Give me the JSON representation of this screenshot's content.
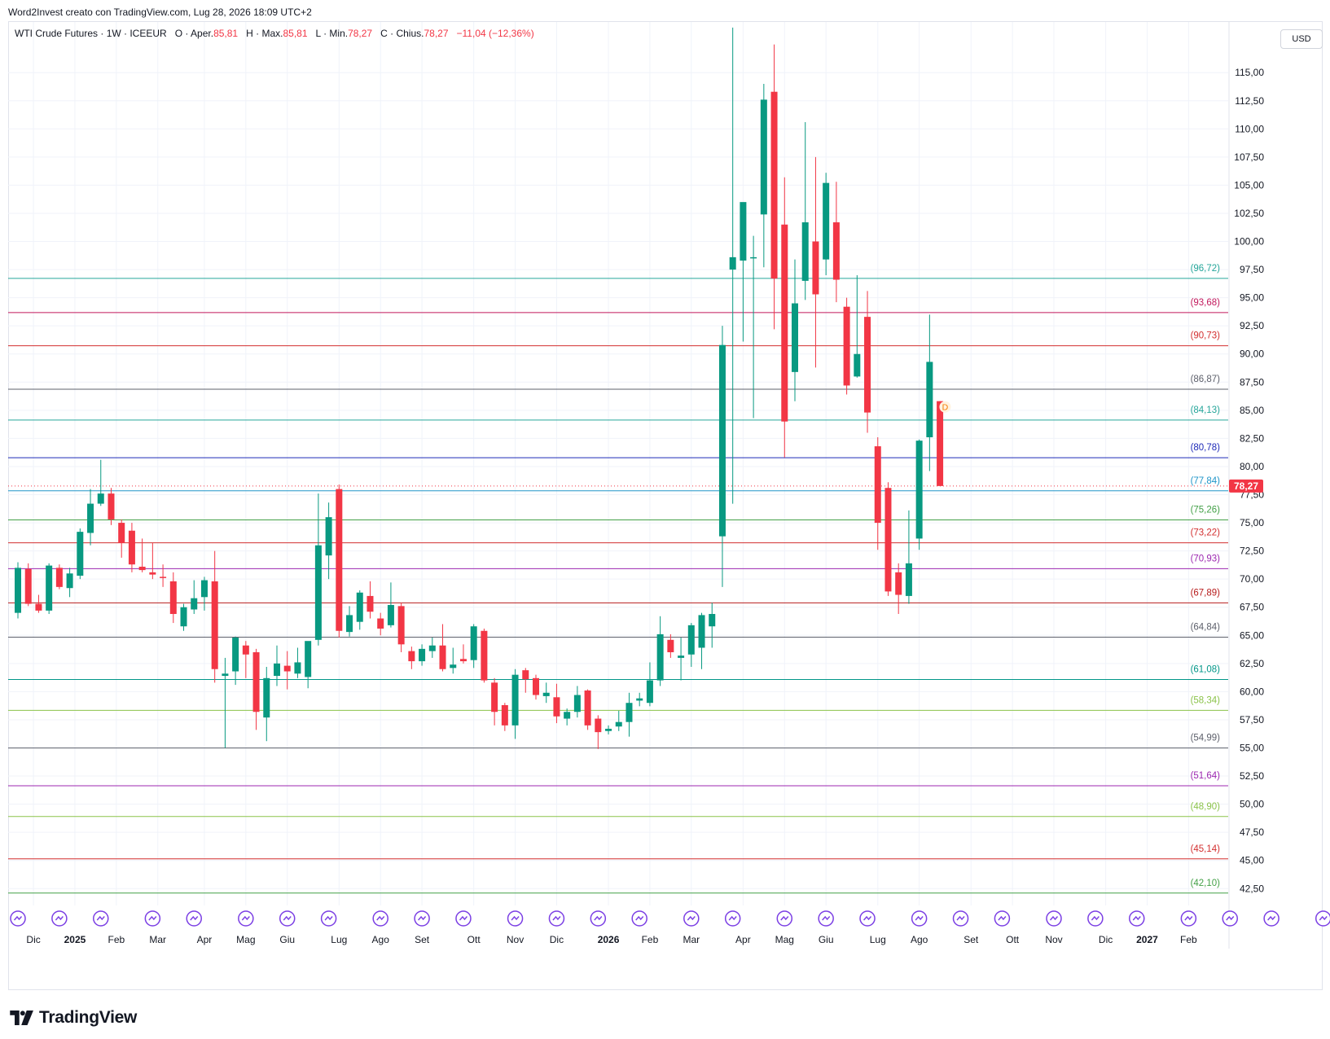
{
  "header": {
    "credit": "Word2Invest creato con TradingView.com, Lug 28, 2026 18:09 UTC+2"
  },
  "legend": {
    "symbol": "WTI Crude Futures · 1W · ICEEUR",
    "open_label": "O · Aper.",
    "open": "85,81",
    "high_label": "H · Max.",
    "high": "85,81",
    "low_label": "L · Min.",
    "low": "78,27",
    "close_label": "C · Chius.",
    "close": "78,27",
    "change": "−11,04 (−12,36%)"
  },
  "currency": "USD",
  "brand": "TradingView",
  "colors": {
    "up": "#089981",
    "down": "#f23645",
    "grid": "#f0f3fa",
    "text": "#131722",
    "event": "#7b3fe4"
  },
  "chart_data": {
    "type": "candlestick",
    "y_axis": {
      "range": [
        41.0,
        119.5
      ],
      "ticks": [
        "42,50",
        "45,00",
        "47,50",
        "50,00",
        "52,50",
        "55,00",
        "57,50",
        "60,00",
        "62,50",
        "65,00",
        "67,50",
        "70,00",
        "72,50",
        "75,00",
        "77,50",
        "80,00",
        "82,50",
        "85,00",
        "87,50",
        "90,00",
        "92,50",
        "95,00",
        "97,50",
        "100,00",
        "102,50",
        "105,00",
        "107,50",
        "110,00",
        "112,50",
        "115,00"
      ]
    },
    "x_axis": {
      "labels": [
        {
          "label": "Dic",
          "bar": 1.5,
          "bold": false
        },
        {
          "label": "2025",
          "bar": 5.5,
          "bold": true
        },
        {
          "label": "Feb",
          "bar": 9.5,
          "bold": false
        },
        {
          "label": "Mar",
          "bar": 13.5,
          "bold": false
        },
        {
          "label": "Apr",
          "bar": 18,
          "bold": false
        },
        {
          "label": "Mag",
          "bar": 22,
          "bold": false
        },
        {
          "label": "Giu",
          "bar": 26,
          "bold": false
        },
        {
          "label": "Lug",
          "bar": 31,
          "bold": false
        },
        {
          "label": "Ago",
          "bar": 35,
          "bold": false
        },
        {
          "label": "Set",
          "bar": 39,
          "bold": false
        },
        {
          "label": "Ott",
          "bar": 44,
          "bold": false
        },
        {
          "label": "Nov",
          "bar": 48,
          "bold": false
        },
        {
          "label": "Dic",
          "bar": 52,
          "bold": false
        },
        {
          "label": "2026",
          "bar": 57,
          "bold": true
        },
        {
          "label": "Feb",
          "bar": 61,
          "bold": false
        },
        {
          "label": "Mar",
          "bar": 65,
          "bold": false
        },
        {
          "label": "Apr",
          "bar": 70,
          "bold": false
        },
        {
          "label": "Mag",
          "bar": 74,
          "bold": false
        },
        {
          "label": "Giu",
          "bar": 78,
          "bold": false
        },
        {
          "label": "Lug",
          "bar": 83,
          "bold": false
        },
        {
          "label": "Ago",
          "bar": 87,
          "bold": false
        },
        {
          "label": "Set",
          "bar": 92,
          "bold": false
        },
        {
          "label": "Ott",
          "bar": 96,
          "bold": false
        },
        {
          "label": "Nov",
          "bar": 100,
          "bold": false
        },
        {
          "label": "Dic",
          "bar": 105,
          "bold": false
        },
        {
          "label": "2027",
          "bar": 109,
          "bold": true
        },
        {
          "label": "Feb",
          "bar": 113,
          "bold": false
        }
      ]
    },
    "event_markers": [
      0,
      4,
      8,
      13,
      17,
      22,
      26,
      30,
      35,
      39,
      43,
      48,
      52,
      56,
      60,
      65,
      69,
      74,
      78,
      82,
      87,
      91,
      95,
      100,
      104,
      108,
      113,
      117,
      121,
      126,
      130,
      134
    ],
    "levels": [
      {
        "value": 96.72,
        "label": "(96,72)",
        "color": "#26a69a"
      },
      {
        "value": 93.68,
        "label": "(93,68)",
        "color": "#c2185b"
      },
      {
        "value": 90.73,
        "label": "(90,73)",
        "color": "#d32f2f"
      },
      {
        "value": 86.87,
        "label": "(86,87)",
        "color": "#5d606b"
      },
      {
        "value": 84.13,
        "label": "(84,13)",
        "color": "#26a69a"
      },
      {
        "value": 80.78,
        "label": "(80,78)",
        "color": "#1e2ab8"
      },
      {
        "value": 77.84,
        "label": "(77,84)",
        "color": "#2196c9"
      },
      {
        "value": 75.26,
        "label": "(75,26)",
        "color": "#43a047"
      },
      {
        "value": 73.22,
        "label": "(73,22)",
        "color": "#d32f2f"
      },
      {
        "value": 70.93,
        "label": "(70,93)",
        "color": "#9c27b0"
      },
      {
        "value": 67.89,
        "label": "(67,89)",
        "color": "#b71c1c"
      },
      {
        "value": 64.84,
        "label": "(64,84)",
        "color": "#5d606b"
      },
      {
        "value": 61.08,
        "label": "(61,08)",
        "color": "#009688"
      },
      {
        "value": 58.34,
        "label": "(58,34)",
        "color": "#8bc34a"
      },
      {
        "value": 54.99,
        "label": "(54,99)",
        "color": "#5d606b"
      },
      {
        "value": 51.64,
        "label": "(51,64)",
        "color": "#9c27b0"
      },
      {
        "value": 48.9,
        "label": "(48,90)",
        "color": "#8bc34a"
      },
      {
        "value": 45.14,
        "label": "(45,14)",
        "color": "#d32f2f"
      },
      {
        "value": 42.1,
        "label": "(42,10)",
        "color": "#43a047"
      }
    ],
    "last_price": {
      "value": 78.27,
      "label": "78,27"
    },
    "dividend_marker": {
      "bar": 89.5,
      "value": 85.3,
      "label": "D"
    },
    "candles": [
      {
        "o": 67.0,
        "h": 71.5,
        "l": 66.5,
        "c": 71.0
      },
      {
        "o": 70.9,
        "h": 71.4,
        "l": 67.6,
        "c": 67.8
      },
      {
        "o": 67.8,
        "h": 68.6,
        "l": 67.0,
        "c": 67.2
      },
      {
        "o": 67.2,
        "h": 71.4,
        "l": 66.9,
        "c": 71.2
      },
      {
        "o": 71.0,
        "h": 71.3,
        "l": 69.1,
        "c": 69.3
      },
      {
        "o": 69.2,
        "h": 71.0,
        "l": 68.4,
        "c": 70.5
      },
      {
        "o": 70.3,
        "h": 74.5,
        "l": 70.0,
        "c": 74.2
      },
      {
        "o": 74.1,
        "h": 78.0,
        "l": 73.0,
        "c": 76.7
      },
      {
        "o": 76.7,
        "h": 80.6,
        "l": 76.5,
        "c": 77.6
      },
      {
        "o": 77.6,
        "h": 78.1,
        "l": 74.8,
        "c": 75.3
      },
      {
        "o": 75.0,
        "h": 75.3,
        "l": 71.9,
        "c": 73.2
      },
      {
        "o": 74.3,
        "h": 75.0,
        "l": 70.6,
        "c": 71.3
      },
      {
        "o": 71.1,
        "h": 73.6,
        "l": 70.6,
        "c": 70.8
      },
      {
        "o": 70.6,
        "h": 73.2,
        "l": 70.0,
        "c": 70.4
      },
      {
        "o": 70.2,
        "h": 71.3,
        "l": 69.3,
        "c": 70.1
      },
      {
        "o": 69.8,
        "h": 70.6,
        "l": 66.1,
        "c": 66.9
      },
      {
        "o": 65.8,
        "h": 67.8,
        "l": 65.4,
        "c": 67.5
      },
      {
        "o": 67.3,
        "h": 69.9,
        "l": 66.9,
        "c": 68.3
      },
      {
        "o": 68.4,
        "h": 70.2,
        "l": 67.2,
        "c": 69.9
      },
      {
        "o": 69.8,
        "h": 72.5,
        "l": 60.8,
        "c": 62.0
      },
      {
        "o": 61.4,
        "h": 63.0,
        "l": 55.0,
        "c": 61.6
      },
      {
        "o": 61.8,
        "h": 64.9,
        "l": 60.6,
        "c": 64.8
      },
      {
        "o": 64.1,
        "h": 64.5,
        "l": 61.2,
        "c": 63.3
      },
      {
        "o": 63.5,
        "h": 63.8,
        "l": 56.6,
        "c": 58.2
      },
      {
        "o": 57.7,
        "h": 62.2,
        "l": 55.6,
        "c": 61.2
      },
      {
        "o": 61.4,
        "h": 64.1,
        "l": 60.5,
        "c": 62.5
      },
      {
        "o": 62.3,
        "h": 63.6,
        "l": 60.2,
        "c": 61.8
      },
      {
        "o": 61.6,
        "h": 63.9,
        "l": 61.2,
        "c": 62.6
      },
      {
        "o": 61.3,
        "h": 63.8,
        "l": 60.3,
        "c": 64.5
      },
      {
        "o": 64.6,
        "h": 77.6,
        "l": 64.1,
        "c": 73.0
      },
      {
        "o": 72.1,
        "h": 76.8,
        "l": 70.0,
        "c": 75.5
      },
      {
        "o": 78.0,
        "h": 78.4,
        "l": 64.8,
        "c": 65.4
      },
      {
        "o": 65.3,
        "h": 67.6,
        "l": 64.9,
        "c": 66.8
      },
      {
        "o": 66.2,
        "h": 69.0,
        "l": 65.5,
        "c": 68.8
      },
      {
        "o": 68.5,
        "h": 69.8,
        "l": 66.5,
        "c": 67.1
      },
      {
        "o": 66.5,
        "h": 67.0,
        "l": 65.0,
        "c": 65.6
      },
      {
        "o": 65.9,
        "h": 69.7,
        "l": 65.7,
        "c": 67.7
      },
      {
        "o": 67.6,
        "h": 67.9,
        "l": 63.5,
        "c": 64.2
      },
      {
        "o": 63.6,
        "h": 64.0,
        "l": 62.0,
        "c": 62.7
      },
      {
        "o": 62.7,
        "h": 64.2,
        "l": 62.3,
        "c": 63.8
      },
      {
        "o": 63.6,
        "h": 64.8,
        "l": 63.0,
        "c": 64.1
      },
      {
        "o": 64.1,
        "h": 66.0,
        "l": 61.8,
        "c": 62.0
      },
      {
        "o": 62.1,
        "h": 63.9,
        "l": 61.6,
        "c": 62.4
      },
      {
        "o": 62.9,
        "h": 64.2,
        "l": 62.5,
        "c": 62.7
      },
      {
        "o": 62.8,
        "h": 66.0,
        "l": 62.1,
        "c": 65.8
      },
      {
        "o": 65.4,
        "h": 65.6,
        "l": 60.8,
        "c": 61.0
      },
      {
        "o": 60.8,
        "h": 61.2,
        "l": 57.0,
        "c": 58.2
      },
      {
        "o": 58.8,
        "h": 59.0,
        "l": 56.5,
        "c": 57.0
      },
      {
        "o": 57.0,
        "h": 62.0,
        "l": 55.8,
        "c": 61.5
      },
      {
        "o": 61.9,
        "h": 62.1,
        "l": 59.9,
        "c": 61.1
      },
      {
        "o": 61.2,
        "h": 61.5,
        "l": 59.3,
        "c": 59.7
      },
      {
        "o": 59.6,
        "h": 60.8,
        "l": 59.0,
        "c": 59.9
      },
      {
        "o": 59.5,
        "h": 60.7,
        "l": 57.2,
        "c": 57.8
      },
      {
        "o": 57.6,
        "h": 58.5,
        "l": 57.0,
        "c": 58.2
      },
      {
        "o": 58.2,
        "h": 60.5,
        "l": 57.7,
        "c": 59.7
      },
      {
        "o": 60.1,
        "h": 60.2,
        "l": 56.6,
        "c": 57.0
      },
      {
        "o": 57.6,
        "h": 57.9,
        "l": 54.9,
        "c": 56.4
      },
      {
        "o": 56.5,
        "h": 57.0,
        "l": 56.2,
        "c": 56.7
      },
      {
        "o": 56.9,
        "h": 58.3,
        "l": 56.5,
        "c": 57.3
      },
      {
        "o": 57.3,
        "h": 59.9,
        "l": 56.0,
        "c": 59.0
      },
      {
        "o": 59.2,
        "h": 59.9,
        "l": 58.7,
        "c": 59.4
      },
      {
        "o": 59.0,
        "h": 62.6,
        "l": 58.7,
        "c": 61.0
      },
      {
        "o": 61.0,
        "h": 66.7,
        "l": 60.5,
        "c": 65.1
      },
      {
        "o": 64.6,
        "h": 65.1,
        "l": 63.0,
        "c": 63.5
      },
      {
        "o": 63.0,
        "h": 64.8,
        "l": 61.0,
        "c": 63.2
      },
      {
        "o": 63.3,
        "h": 66.1,
        "l": 62.2,
        "c": 65.9
      },
      {
        "o": 63.9,
        "h": 67.0,
        "l": 62.0,
        "c": 66.8
      },
      {
        "o": 65.8,
        "h": 67.9,
        "l": 63.9,
        "c": 66.9
      },
      {
        "o": 73.8,
        "h": 92.5,
        "l": 69.3,
        "c": 90.8
      },
      {
        "o": 97.5,
        "h": 119.0,
        "l": 76.7,
        "c": 98.6
      },
      {
        "o": 98.3,
        "h": 102.5,
        "l": 91.1,
        "c": 103.5
      },
      {
        "o": 98.5,
        "h": 100.5,
        "l": 84.3,
        "c": 98.6
      },
      {
        "o": 102.4,
        "h": 114.0,
        "l": 97.7,
        "c": 112.6
      },
      {
        "o": 113.3,
        "h": 117.5,
        "l": 92.2,
        "c": 96.7
      },
      {
        "o": 101.5,
        "h": 105.7,
        "l": 80.8,
        "c": 84.0
      },
      {
        "o": 88.4,
        "h": 98.4,
        "l": 85.8,
        "c": 94.5
      },
      {
        "o": 96.5,
        "h": 110.6,
        "l": 94.8,
        "c": 101.7
      },
      {
        "o": 100.0,
        "h": 107.5,
        "l": 88.8,
        "c": 95.3
      },
      {
        "o": 98.4,
        "h": 106.1,
        "l": 97.0,
        "c": 105.2
      },
      {
        "o": 101.7,
        "h": 105.3,
        "l": 94.6,
        "c": 96.6
      },
      {
        "o": 94.2,
        "h": 95.0,
        "l": 86.4,
        "c": 87.2
      },
      {
        "o": 88.0,
        "h": 97.0,
        "l": 87.9,
        "c": 90.0
      },
      {
        "o": 93.3,
        "h": 95.6,
        "l": 83.0,
        "c": 84.8
      },
      {
        "o": 81.8,
        "h": 82.6,
        "l": 72.6,
        "c": 75.0
      },
      {
        "o": 78.1,
        "h": 78.6,
        "l": 68.5,
        "c": 68.9
      },
      {
        "o": 70.6,
        "h": 71.4,
        "l": 66.9,
        "c": 68.6
      },
      {
        "o": 68.5,
        "h": 76.1,
        "l": 67.8,
        "c": 71.4
      },
      {
        "o": 73.6,
        "h": 82.4,
        "l": 72.6,
        "c": 82.3
      },
      {
        "o": 82.6,
        "h": 93.5,
        "l": 79.6,
        "c": 89.3
      },
      {
        "o": 85.81,
        "h": 85.81,
        "l": 78.27,
        "c": 78.27
      }
    ]
  }
}
